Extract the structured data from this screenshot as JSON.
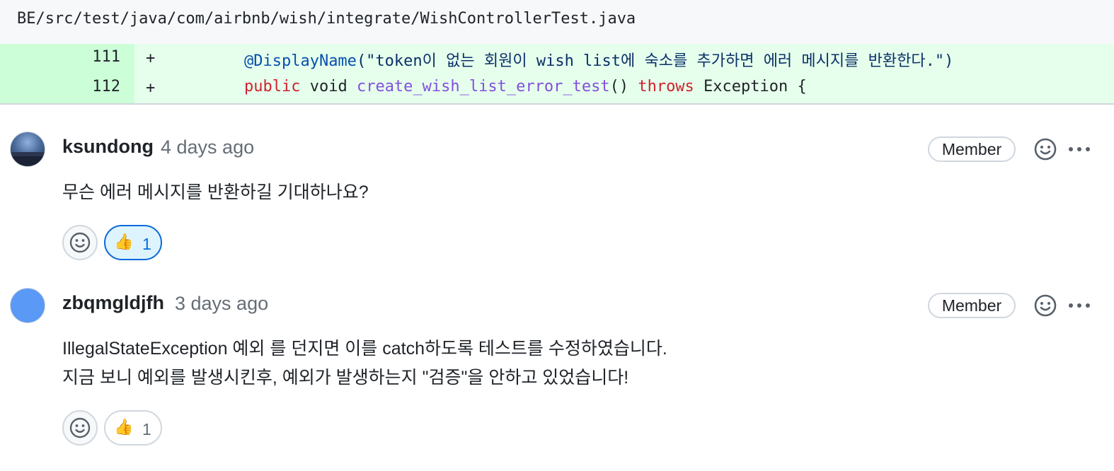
{
  "file": {
    "path": "BE/src/test/java/com/airbnb/wish/integrate/WishControllerTest.java"
  },
  "diff": {
    "lines": [
      {
        "number": "111",
        "marker": "+",
        "tokens": [
          {
            "text": "    "
          },
          {
            "text": "@DisplayName",
            "kind": "anno"
          },
          {
            "text": "(\"token이 없는 회원이 wish list에 숙소를 추가하면 에러 메시지를 반환한다.\")",
            "kind": "str"
          }
        ]
      },
      {
        "number": "112",
        "marker": "+",
        "tokens": [
          {
            "text": "    "
          },
          {
            "text": "public",
            "kind": "kw"
          },
          {
            "text": " void "
          },
          {
            "text": "create_wish_list_error_test",
            "kind": "fn"
          },
          {
            "text": "() "
          },
          {
            "text": "throws",
            "kind": "kw"
          },
          {
            "text": " Exception {"
          }
        ]
      }
    ]
  },
  "comments": [
    {
      "author": "ksundong",
      "time": "4 days ago",
      "badge": "Member",
      "body": [
        "무슨 에러 메시지를 반환하길 기대하나요?"
      ],
      "reaction": {
        "emoji": "👍",
        "count": "1",
        "active": true
      }
    },
    {
      "author": "zbqmgldjfh",
      "time": "3 days ago",
      "badge": "Member",
      "body": [
        "IllegalStateException 예외 를 던지면 이를 catch하도록 테스트를 수정하였습니다.",
        "지금 보니 예외를 발생시킨후, 예외가 발생하는지 \"검증\"을 안하고 있었습니다!"
      ],
      "reaction": {
        "emoji": "👍",
        "count": "1",
        "active": false
      }
    }
  ],
  "icons": {
    "add_reaction": "smiley-icon",
    "more": "kebab-horizontal-icon"
  },
  "colors": {
    "diff_add_bg": "#e6ffec",
    "diff_add_num_bg": "#ccffd8",
    "link_blue": "#0969da",
    "keyword_red": "#cf222e",
    "function_purple": "#8250df"
  }
}
